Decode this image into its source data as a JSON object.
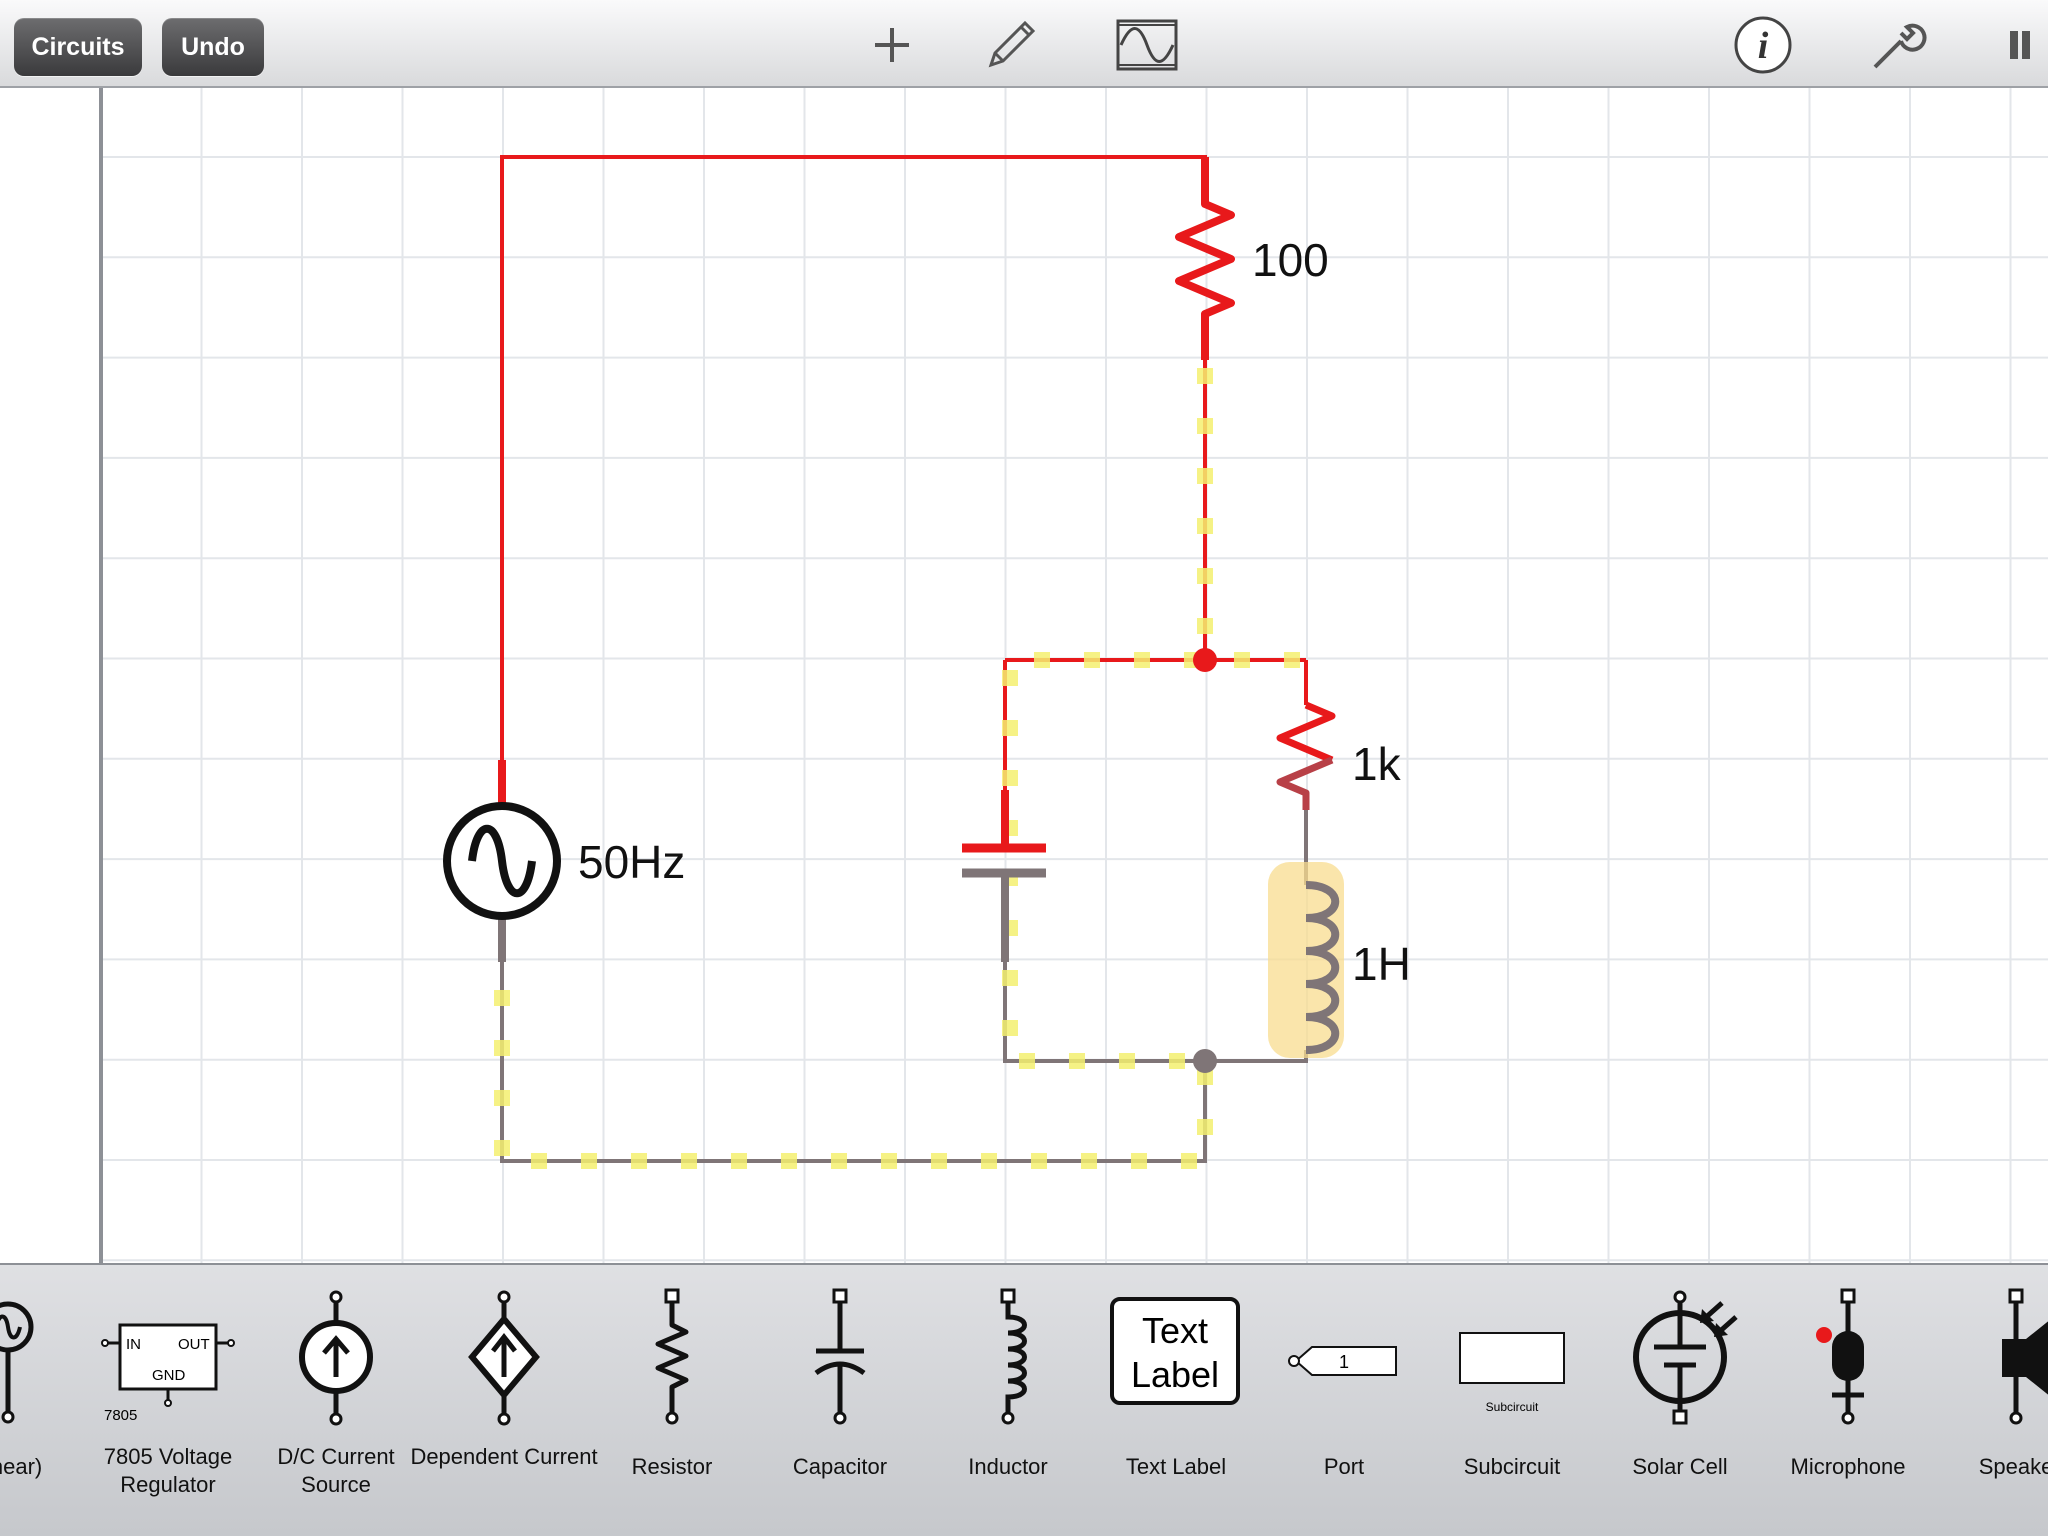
{
  "toolbar": {
    "circuits_label": "Circuits",
    "undo_label": "Undo",
    "icons": [
      "plus-icon",
      "pencil-icon",
      "oscilloscope-icon",
      "info-icon",
      "wrench-icon",
      "pause-icon"
    ]
  },
  "circuit": {
    "source_label": "50Hz",
    "r1_label": "100",
    "r2_label": "1k",
    "inductor_label": "1H",
    "colors": {
      "high": "#e8191b",
      "low": "#7f7577",
      "current": "#f4f070",
      "grid": "#e3e6ea"
    }
  },
  "palette": {
    "items": [
      {
        "label": "(linear)",
        "icon": "ac-source-icon"
      },
      {
        "label": "7805 Voltage Regulator",
        "icon": "voltage-regulator-icon",
        "chip_in": "IN",
        "chip_out": "OUT",
        "chip_gnd": "GND",
        "chip_part": "7805"
      },
      {
        "label": "D/C Current Source",
        "icon": "current-source-icon"
      },
      {
        "label": "Dependent Current",
        "icon": "dependent-current-icon"
      },
      {
        "label": "Resistor",
        "icon": "resistor-icon"
      },
      {
        "label": "Capacitor",
        "icon": "capacitor-icon"
      },
      {
        "label": "Inductor",
        "icon": "inductor-icon"
      },
      {
        "label": "Text Label",
        "icon": "text-label-icon",
        "box_text_1": "Text",
        "box_text_2": "Label"
      },
      {
        "label": "Port",
        "icon": "port-icon",
        "port_number": "1"
      },
      {
        "label": "Subcircuit",
        "icon": "subcircuit-icon",
        "box_caption": "Subcircuit"
      },
      {
        "label": "Solar Cell",
        "icon": "solar-cell-icon"
      },
      {
        "label": "Microphone",
        "icon": "microphone-icon"
      },
      {
        "label": "Speake",
        "icon": "speaker-icon"
      }
    ]
  }
}
